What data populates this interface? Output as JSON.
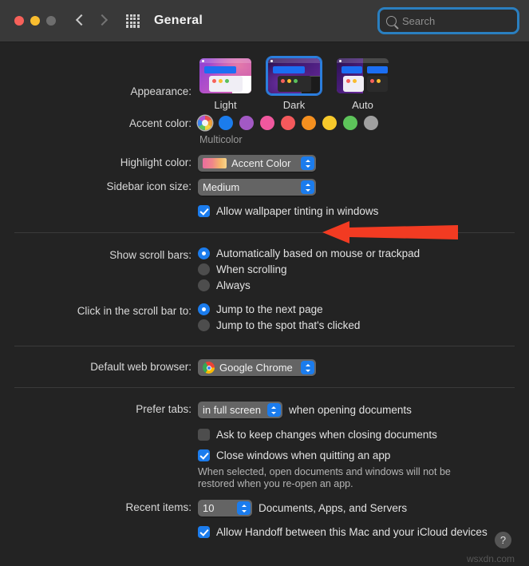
{
  "titlebar": {
    "title": "General",
    "back_icon": "chevron-left-icon",
    "forward_icon": "chevron-right-icon",
    "grid_icon": "grid-apps-icon",
    "search_placeholder": "Search",
    "search_value": ""
  },
  "appearance": {
    "label": "Appearance:",
    "options": [
      {
        "name": "Light",
        "selected": false
      },
      {
        "name": "Dark",
        "selected": true
      },
      {
        "name": "Auto",
        "selected": false
      }
    ]
  },
  "accent": {
    "label": "Accent color:",
    "selected": "Multicolor",
    "caption": "Multicolor",
    "swatches": [
      {
        "name": "Multicolor",
        "color": "#multicolor",
        "selected": true
      },
      {
        "name": "Blue",
        "color": "#1b7ced",
        "selected": false
      },
      {
        "name": "Purple",
        "color": "#a259c4",
        "selected": false
      },
      {
        "name": "Pink",
        "color": "#f0589e",
        "selected": false
      },
      {
        "name": "Red",
        "color": "#f4595c",
        "selected": false
      },
      {
        "name": "Orange",
        "color": "#f5901f",
        "selected": false
      },
      {
        "name": "Yellow",
        "color": "#f7c92b",
        "selected": false
      },
      {
        "name": "Green",
        "color": "#5dc45a",
        "selected": false
      },
      {
        "name": "Graphite",
        "color": "#a0a0a0",
        "selected": false
      }
    ]
  },
  "highlight": {
    "label": "Highlight color:",
    "value": "Accent Color"
  },
  "sidebar_icon_size": {
    "label": "Sidebar icon size:",
    "value": "Medium"
  },
  "wallpaper_tinting": {
    "label": "Allow wallpaper tinting in windows",
    "checked": true
  },
  "scroll_bars": {
    "label": "Show scroll bars:",
    "options": [
      {
        "label": "Automatically based on mouse or trackpad",
        "selected": true
      },
      {
        "label": "When scrolling",
        "selected": false
      },
      {
        "label": "Always",
        "selected": false
      }
    ]
  },
  "scroll_click": {
    "label": "Click in the scroll bar to:",
    "options": [
      {
        "label": "Jump to the next page",
        "selected": true
      },
      {
        "label": "Jump to the spot that's clicked",
        "selected": false
      }
    ]
  },
  "browser": {
    "label": "Default web browser:",
    "value": "Google Chrome",
    "icon": "chrome-icon"
  },
  "tabs": {
    "label": "Prefer tabs:",
    "value": "in full screen",
    "suffix": "when opening documents"
  },
  "ask_keep_changes": {
    "label": "Ask to keep changes when closing documents",
    "checked": false
  },
  "close_windows": {
    "label": "Close windows when quitting an app",
    "checked": true,
    "help": "When selected, open documents and windows will not be restored when you re-open an app."
  },
  "recent_items": {
    "label": "Recent items:",
    "value": "10",
    "suffix": "Documents, Apps, and Servers"
  },
  "handoff": {
    "label": "Allow Handoff between this Mac and your iCloud devices",
    "checked": true
  },
  "help_button": "?",
  "watermark": "wsxdn.com",
  "annotation": {
    "type": "arrow",
    "color": "#f23b22",
    "points_to": "sidebar-icon-size-popup"
  }
}
